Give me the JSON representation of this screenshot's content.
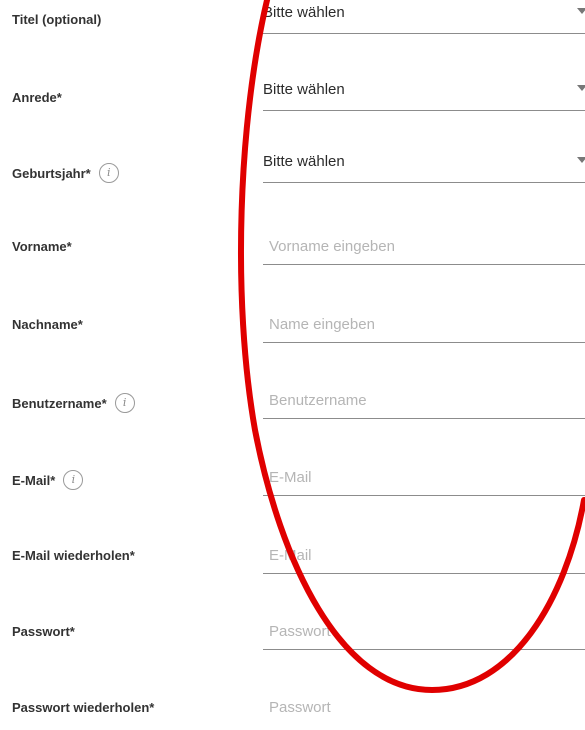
{
  "form": {
    "titel": {
      "label": "Titel (optional)",
      "value": "Bitte wählen"
    },
    "anrede": {
      "label": "Anrede*",
      "value": "Bitte wählen"
    },
    "geburtsjahr": {
      "label": "Geburtsjahr*",
      "value": "Bitte wählen",
      "info_icon": "i"
    },
    "vorname": {
      "label": "Vorname*",
      "placeholder": "Vorname eingeben"
    },
    "nachname": {
      "label": "Nachname*",
      "placeholder": "Name eingeben"
    },
    "benutzername": {
      "label": "Benutzername*",
      "placeholder": "Benutzername",
      "info_icon": "i"
    },
    "email": {
      "label": "E-Mail*",
      "placeholder": "E-Mail",
      "info_icon": "i"
    },
    "email_repeat": {
      "label": "E-Mail wiederholen*",
      "placeholder": "E-Mail"
    },
    "passwort": {
      "label": "Passwort*",
      "placeholder": "Passwort"
    },
    "passwort_repeat": {
      "label": "Passwort wiederholen*",
      "placeholder": "Passwort"
    }
  },
  "annotation": {
    "shape": "ellipse",
    "color": "#e00000"
  }
}
